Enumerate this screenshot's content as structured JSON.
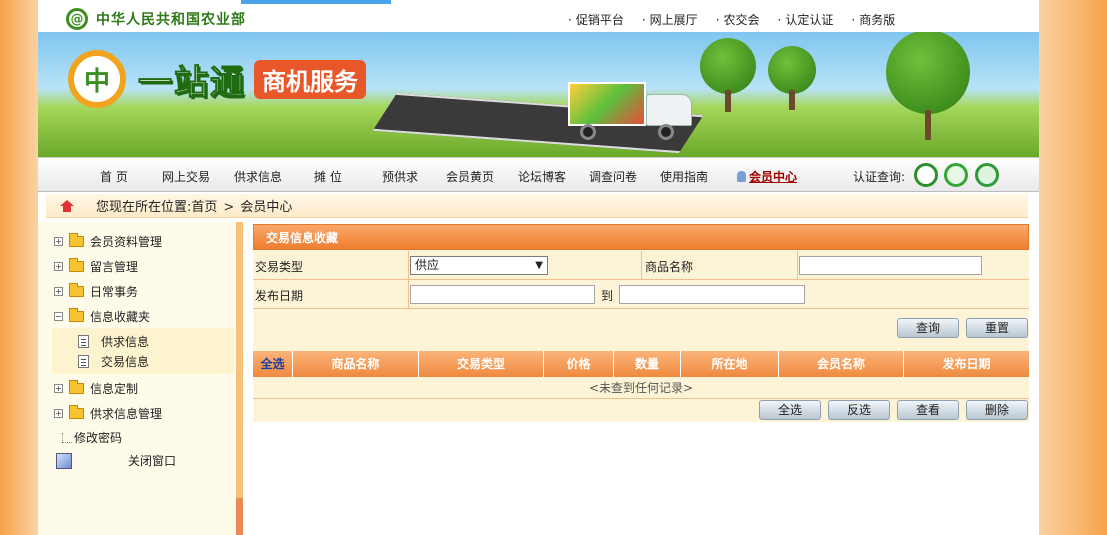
{
  "header": {
    "org_name": "中华人民共和国农业部",
    "top_links": [
      "促销平台",
      "网上展厅",
      "农交会",
      "认定认证",
      "商务版"
    ]
  },
  "banner": {
    "brand_main": "一站通",
    "brand_sub": "商机服务"
  },
  "nav": {
    "items": [
      "首 页",
      "网上交易",
      "供求信息",
      "摊 位",
      "预供求",
      "会员黄页",
      "论坛博客",
      "调查问卷",
      "使用指南"
    ],
    "member_center": "会员中心",
    "cert_label": "认证查询:"
  },
  "breadcrumb": {
    "prefix": "您现在所在位置:",
    "home": "首页",
    "current": "会员中心"
  },
  "sidebar": {
    "items": [
      "会员资料管理",
      "留言管理",
      "日常事务",
      "信息收藏夹"
    ],
    "sub_items": [
      "供求信息",
      "交易信息"
    ],
    "items_after": [
      "信息定制",
      "供求信息管理"
    ],
    "change_password": "修改密码",
    "close_window": "关闭窗口"
  },
  "panel": {
    "title": "交易信息收藏",
    "trade_type_label": "交易类型",
    "trade_type_value": "供应",
    "product_name_label": "商品名称",
    "product_name_value": "",
    "date_label": "发布日期",
    "date_to": "到",
    "date_from_value": "",
    "date_to_value": "",
    "query_button": "查询",
    "reset_button": "重置",
    "columns": [
      "全选",
      "商品名称",
      "交易类型",
      "价格",
      "数量",
      "所在地",
      "会员名称",
      "发布日期"
    ],
    "empty_message": "<未查到任何记录>",
    "select_all_button": "全选",
    "invert_button": "反选",
    "view_button": "查看",
    "delete_button": "删除"
  }
}
